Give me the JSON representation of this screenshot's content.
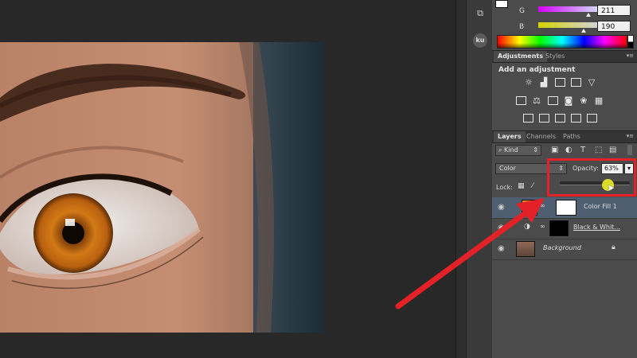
{
  "color_panel": {
    "g_label": "G",
    "g_value": "211",
    "b_label": "B",
    "b_value": "190"
  },
  "adjustments": {
    "tabs": [
      "Adjustments",
      "Styles"
    ],
    "heading": "Add an adjustment",
    "row1_icons": [
      "brightness-icon",
      "levels-icon",
      "curves-icon",
      "exposure-icon",
      "vibrance-icon"
    ],
    "row2_icons": [
      "hue-saturation-icon",
      "color-balance-icon",
      "black-white-icon",
      "photo-filter-icon",
      "channel-mixer-icon",
      "color-lookup-icon"
    ],
    "row3_icons": [
      "invert-icon",
      "posterize-icon",
      "threshold-icon",
      "gradient-map-icon",
      "selective-color-icon"
    ]
  },
  "layers": {
    "tabs": [
      "Layers",
      "Channels",
      "Paths"
    ],
    "filter_kind": "Kind",
    "blend_mode": "Color",
    "opacity_label": "Opacity:",
    "opacity_value": "63%",
    "opacity_fraction": 0.63,
    "lock_label": "Lock:",
    "items": [
      {
        "name": "Color Fill 1",
        "selected": true
      },
      {
        "name": "Black & Whit...",
        "selected": false
      },
      {
        "name": "Background",
        "selected": false
      }
    ]
  },
  "tools": {
    "ku_label": "ku"
  },
  "colors": {
    "fill_swatch": "#f5831f",
    "highlight": "#e42127",
    "panel_bg": "#4b4b4b",
    "selected_layer": "#4f5f71"
  }
}
